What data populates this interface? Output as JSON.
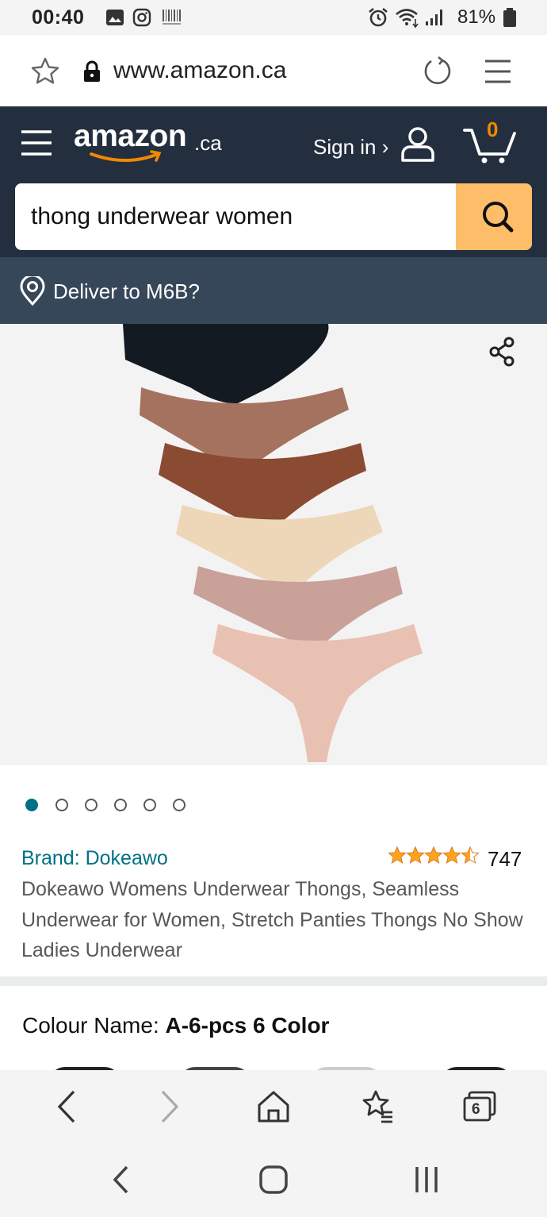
{
  "status_bar": {
    "time": "00:40",
    "battery": "81%",
    "icons": [
      "gallery-icon",
      "instagram-icon",
      "barcode-icon",
      "alarm-icon",
      "wifi-icon",
      "signal-icon",
      "battery-icon"
    ]
  },
  "browser": {
    "url": "www.amazon.ca",
    "icons": [
      "star-icon",
      "lock-icon",
      "reload-icon",
      "menu-icon"
    ]
  },
  "header": {
    "logo": "amazon",
    "logo_suffix": ".ca",
    "sign_in": "Sign in ›",
    "cart_count": "0",
    "colors": {
      "background": "#232f3e",
      "accent": "#febd69",
      "cart": "#f08804"
    }
  },
  "search": {
    "value": "thong underwear women"
  },
  "deliver": {
    "text": "Deliver to M6B?"
  },
  "product": {
    "image_count": 6,
    "active_image": 1,
    "brand": "Brand: Dokeawo",
    "rating": 4.5,
    "stars": "★★★★★",
    "rating_count": "747",
    "title": "Dokeawo Womens Underwear Thongs, Seamless Underwear for Women, Stretch Panties Thongs No Show Ladies Underwear",
    "colour_label": "Colour Name: ",
    "colour_value": "A-6-pcs 6 Color",
    "swatch_colors": [
      "#1a1f26",
      "#a87764",
      "#8a4a33",
      "#eed8bb",
      "#c9a39a",
      "#e9c0b2"
    ]
  },
  "browser_nav": {
    "tab_count": "6",
    "icons": [
      "back-icon",
      "forward-icon",
      "home-icon",
      "bookmarks-icon",
      "tabs-icon"
    ]
  },
  "system_nav": {
    "icons": [
      "system-back-icon",
      "system-home-icon",
      "recent-apps-icon"
    ]
  }
}
